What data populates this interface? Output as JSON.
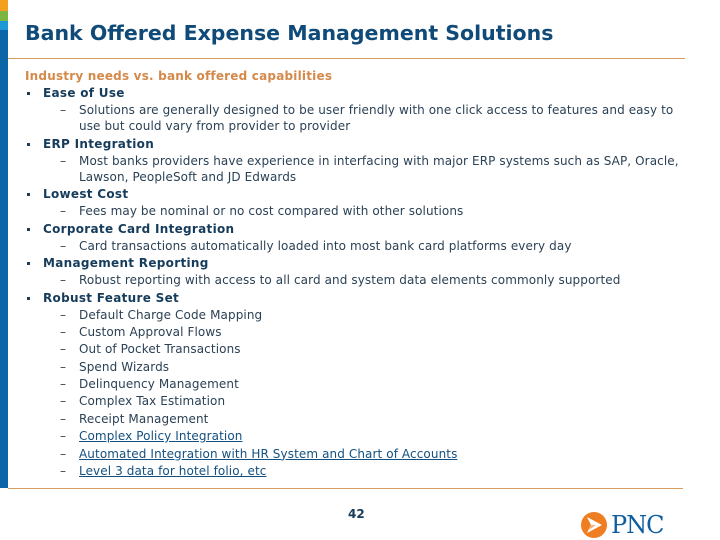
{
  "slide": {
    "title": "Bank Offered Expense Management Solutions",
    "subheading": "Industry needs vs. bank offered capabilities",
    "page_number": "42",
    "brand": {
      "name": "PNC",
      "colors": {
        "title": "#0f4a78",
        "subheading": "#d4894a",
        "rule": "#d89c5c",
        "sidebar_orange": "#f3a01f",
        "sidebar_green": "#7bb642",
        "sidebar_light_blue": "#1f98d6",
        "sidebar_blue": "#0b65a7",
        "logo_orange": "#ef7d22",
        "logo_blue": "#0f5fa0"
      }
    },
    "sections": [
      {
        "heading": "Ease of Use",
        "details": [
          "Solutions are generally designed to be user friendly with one click access to features and easy to use but could vary from provider to provider"
        ]
      },
      {
        "heading": "ERP Integration",
        "details": [
          "Most banks providers have experience in interfacing with major ERP systems such as SAP, Oracle, Lawson, PeopleSoft and JD Edwards"
        ]
      },
      {
        "heading": "Lowest Cost",
        "details": [
          "Fees may be nominal or no cost compared with other solutions"
        ]
      },
      {
        "heading": "Corporate Card Integration",
        "details": [
          "Card transactions automatically loaded into most bank card platforms every day"
        ]
      },
      {
        "heading": "Management Reporting",
        "details": [
          "Robust reporting with access to all card and system data elements commonly supported"
        ]
      },
      {
        "heading": "Robust Feature Set",
        "features": [
          {
            "label": "Default Charge Code Mapping",
            "link": false
          },
          {
            "label": "Custom Approval Flows",
            "link": false
          },
          {
            "label": "Out of Pocket Transactions",
            "link": false
          },
          {
            "label": "Spend Wizards",
            "link": false
          },
          {
            "label": "Delinquency Management",
            "link": false
          },
          {
            "label": "Complex Tax Estimation",
            "link": false
          },
          {
            "label": "Receipt Management",
            "link": false
          },
          {
            "label": "Complex Policy Integration",
            "link": true
          },
          {
            "label": "Automated Integration with HR System and Chart of Accounts",
            "link": true
          },
          {
            "label": "Level 3 data for hotel folio, etc",
            "link": true
          }
        ]
      }
    ],
    "glyphs": {
      "bullet": "▪",
      "dash": "–"
    }
  }
}
